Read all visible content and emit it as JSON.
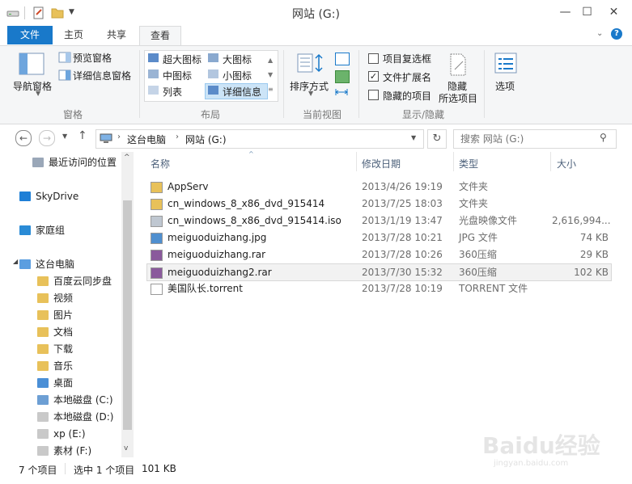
{
  "window": {
    "title": "网站 (G:)",
    "minimize": "—",
    "maximize": "☐",
    "close": "✕"
  },
  "ribbon_tabs": [
    "文件",
    "主页",
    "共享",
    "查看"
  ],
  "ribbon": {
    "panes": {
      "nav_pane": "导航窗格",
      "preview_pane": "预览窗格",
      "details_pane": "详细信息窗格",
      "group": "窗格"
    },
    "layout": {
      "extra_large": "超大图标",
      "large": "大图标",
      "medium": "中图标",
      "small": "小图标",
      "list": "列表",
      "details": "详细信息",
      "group": "布局"
    },
    "current_view": {
      "sort_by": "排序方式",
      "group": "当前视图"
    },
    "show_hide": {
      "item_checkboxes": "项目复选框",
      "file_extensions": "文件扩展名",
      "hidden_items": "隐藏的项目",
      "hide_selected_line1": "隐藏",
      "hide_selected_line2": "所选项目",
      "group": "显示/隐藏",
      "item_checkboxes_checked": false,
      "file_extensions_checked": true,
      "hidden_items_checked": false
    },
    "options": "选项"
  },
  "address": {
    "crumbs": [
      "这台电脑",
      "网站 (G:)"
    ],
    "search_placeholder": "搜索 网站 (G:)"
  },
  "nav": [
    {
      "label": "最近访问的位置",
      "icon": "recent-icon"
    },
    {
      "label": "SkyDrive",
      "icon": "skydrive-icon"
    },
    {
      "label": "家庭组",
      "icon": "homegroup-icon"
    },
    {
      "label": "这台电脑",
      "icon": "computer-icon"
    },
    {
      "label": "百度云同步盘",
      "icon": "folder-icon"
    },
    {
      "label": "视频",
      "icon": "videos-icon"
    },
    {
      "label": "图片",
      "icon": "pictures-icon"
    },
    {
      "label": "文档",
      "icon": "documents-icon"
    },
    {
      "label": "下载",
      "icon": "downloads-icon"
    },
    {
      "label": "音乐",
      "icon": "music-icon"
    },
    {
      "label": "桌面",
      "icon": "desktop-icon"
    },
    {
      "label": "本地磁盘 (C:)",
      "icon": "system-drive-icon"
    },
    {
      "label": "本地磁盘 (D:)",
      "icon": "drive-icon"
    },
    {
      "label": "xp (E:)",
      "icon": "drive-icon"
    },
    {
      "label": "素材 (F:)",
      "icon": "drive-icon"
    }
  ],
  "columns": {
    "name": "名称",
    "date": "修改日期",
    "type": "类型",
    "size": "大小"
  },
  "files": [
    {
      "name": "AppServ",
      "date": "2013/4/26 19:19",
      "type": "文件夹",
      "size": "",
      "icon": "folder-icon"
    },
    {
      "name": "cn_windows_8_x86_dvd_915414",
      "date": "2013/7/25 18:03",
      "type": "文件夹",
      "size": "",
      "icon": "folder-icon"
    },
    {
      "name": "cn_windows_8_x86_dvd_915414.iso",
      "date": "2013/1/19 13:47",
      "type": "光盘映像文件",
      "size": "2,616,994...",
      "icon": "disc-image-icon"
    },
    {
      "name": "meiguoduizhang.jpg",
      "date": "2013/7/28 10:21",
      "type": "JPG 文件",
      "size": "74 KB",
      "icon": "image-file-icon"
    },
    {
      "name": "meiguoduizhang.rar",
      "date": "2013/7/28 10:26",
      "type": "360压缩",
      "size": "29 KB",
      "icon": "archive-icon"
    },
    {
      "name": "meiguoduizhang2.rar",
      "date": "2013/7/30 15:32",
      "type": "360压缩",
      "size": "102 KB",
      "icon": "archive-icon"
    },
    {
      "name": "美国队长.torrent",
      "date": "2013/7/28 10:19",
      "type": "TORRENT 文件",
      "size": "",
      "icon": "file-icon"
    }
  ],
  "status": {
    "count": "7 个项目",
    "selected": "选中 1 个项目",
    "selected_size": "101 KB"
  },
  "watermark": {
    "brand": "Baidu经验",
    "url": "jingyan.baidu.com"
  }
}
